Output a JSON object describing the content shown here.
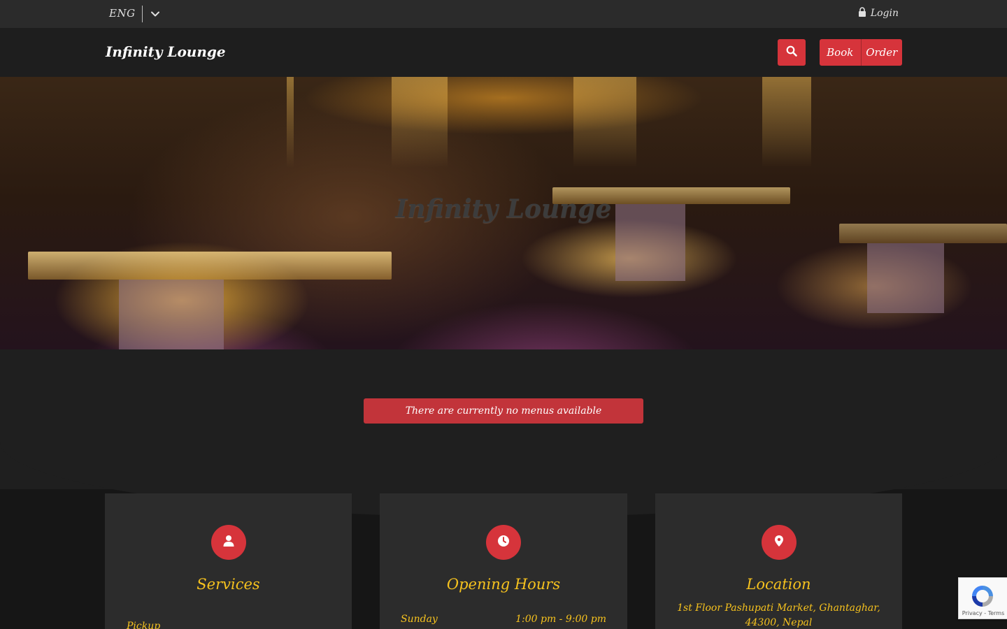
{
  "topbar": {
    "language": "ENG",
    "login_label": "Login"
  },
  "navbar": {
    "brand": "Infinity Lounge",
    "book_label": "Book",
    "order_label": "Order"
  },
  "hero": {
    "title": "Infinity Lounge"
  },
  "alert": {
    "message": "There are currently no menus available"
  },
  "cards": {
    "services": {
      "title": "Services",
      "items": [
        "Pickup"
      ]
    },
    "hours": {
      "title": "Opening Hours",
      "rows": [
        {
          "day": "Sunday",
          "time": "1:00 pm - 9:00 pm"
        }
      ]
    },
    "location": {
      "title": "Location",
      "address_line1": "1st Floor Pashupati Market, Ghantaghar,",
      "address_line2": "44300, Nepal"
    }
  },
  "recaptcha": {
    "terms": "Privacy - Terms"
  },
  "colors": {
    "accent": "#d6343b",
    "gold": "#f6c21e",
    "background": "#1f1f1f",
    "card": "#2c2c2c"
  },
  "icons": {
    "language_toggle": "chevron-down-icon",
    "login": "lock-icon",
    "search": "search-icon",
    "services": "user-icon",
    "hours": "clock-icon",
    "location": "map-pin-icon"
  }
}
